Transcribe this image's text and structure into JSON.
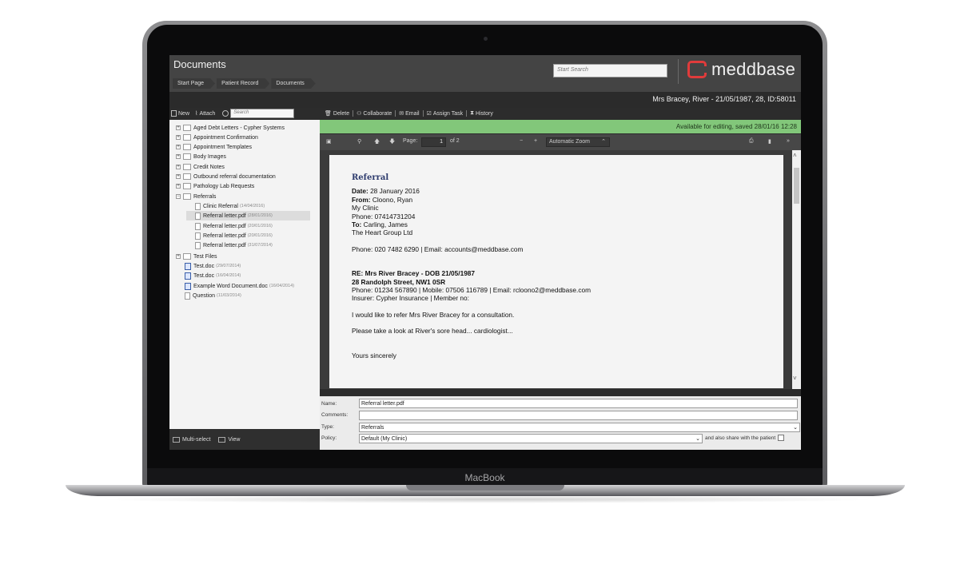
{
  "device": {
    "label": "MacBook"
  },
  "app": {
    "title": "Documents",
    "breadcrumb": [
      "Start Page",
      "Patient Record",
      "Documents"
    ],
    "search_placeholder": "Start Search",
    "brand": "meddbase",
    "patient_info": "Mrs Bracey, River - 21/05/1987, 28, ID:58011"
  },
  "left_toolbar": {
    "new": "New",
    "attach": "Attach",
    "search_placeholder": "Search"
  },
  "tree": {
    "folders": [
      "Aged Debt Letters - Cypher Systems",
      "Appointment Confirmation",
      "Appointment Templates",
      "Body Images",
      "Credit Notes",
      "Outbound referral documentation",
      "Pathology Lab Requests",
      "Referrals"
    ],
    "referral_files": [
      {
        "name": "Clinic Referral",
        "date": "(14/04/2016)"
      },
      {
        "name": "Referral letter.pdf",
        "date": "(28/01/2016)"
      },
      {
        "name": "Referral letter.pdf",
        "date": "(20/01/2016)"
      },
      {
        "name": "Referral letter.pdf",
        "date": "(20/01/2016)"
      },
      {
        "name": "Referral letter.pdf",
        "date": "(31/07/2014)"
      }
    ],
    "test_folder": "Test Files",
    "root_files": [
      {
        "name": "Test.doc",
        "date": "(29/07/2014)"
      },
      {
        "name": "Test.doc",
        "date": "(16/04/2014)"
      },
      {
        "name": "Example Word Document.doc",
        "date": "(16/04/2014)"
      },
      {
        "name": "Question",
        "date": "(11/03/2014)"
      }
    ]
  },
  "left_footer": {
    "multi_select": "Multi-select",
    "view": "View"
  },
  "right_toolbar": {
    "delete": "Delete",
    "collaborate": "Collaborate",
    "email": "Email",
    "assign_task": "Assign Task",
    "history": "History"
  },
  "status": "Available for editing, saved 28/01/16 12:28",
  "viewer": {
    "page_label": "Page:",
    "page": "1",
    "of_pages": "of 2",
    "zoom": "Automatic Zoom"
  },
  "letter": {
    "title": "Referral",
    "date_label": "Date:",
    "date": "28 January 2016",
    "from_label": "From:",
    "from": "Cloono, Ryan",
    "clinic": "My Clinic",
    "phone": "Phone: 07414731204",
    "to_label": "To:",
    "to": "Carling, James",
    "group": "The Heart Group Ltd",
    "contact": "Phone: 020 7482 6290 | Email: accounts@meddbase.com",
    "re": "RE: Mrs River Bracey - DOB 21/05/1987",
    "address": "28 Randolph Street, NW1 0SR",
    "patient_contact": "Phone: 01234 567890 | Mobile: 07506 116789 | Email: rcloono2@meddbase.com",
    "insurer": "Insurer: Cypher Insurance | Member no:",
    "body1": "I would like to refer Mrs River Bracey for a consultation.",
    "body2": "Please take a look at River's sore head... cardiologist...",
    "closing": "Yours sincerely"
  },
  "properties": {
    "name_label": "Name:",
    "name": "Referral letter.pdf",
    "comments_label": "Comments:",
    "comments": "",
    "type_label": "Type:",
    "type": "Referrals",
    "policy_label": "Policy:",
    "policy": "Default (My Clinic)",
    "share_label": "and also share with the patient"
  },
  "colors": {
    "status_green": "#82c77a",
    "brand_red": "#e03b3b"
  }
}
